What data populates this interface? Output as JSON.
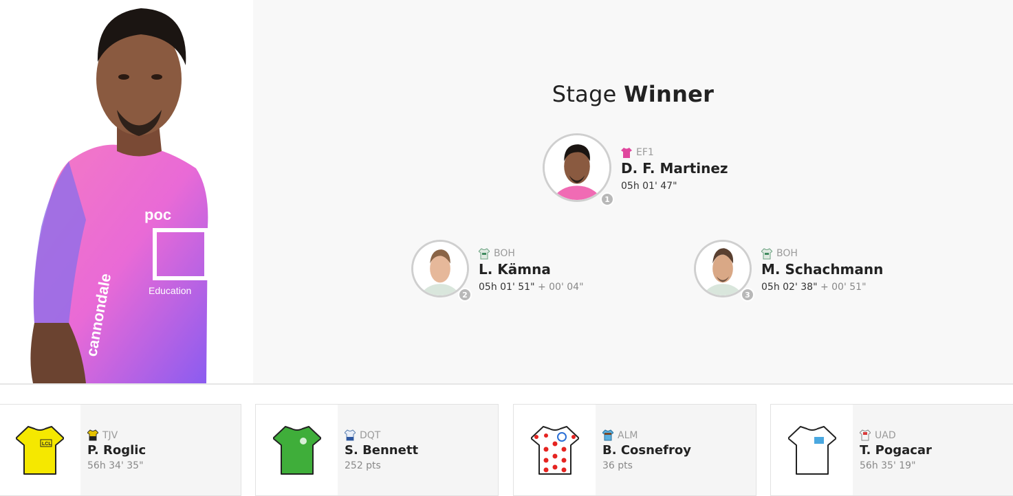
{
  "stage": {
    "title_prefix": "Stage",
    "title_bold": "Winner"
  },
  "podium": [
    {
      "rank": "1",
      "team": "EF1",
      "name": "D. F. Martinez",
      "time": "05h 01' 47\"",
      "gap": ""
    },
    {
      "rank": "2",
      "team": "BOH",
      "name": "L. Kämna",
      "time": "05h 01' 51\"",
      "gap": "+ 00' 04\""
    },
    {
      "rank": "3",
      "team": "BOH",
      "name": "M. Schachmann",
      "time": "05h 02' 38\"",
      "gap": "+ 00' 51\""
    }
  ],
  "jerseys": [
    {
      "type": "yellow",
      "team": "TJV",
      "name": "P. Roglic",
      "value": "56h 34' 35\""
    },
    {
      "type": "green",
      "team": "DQT",
      "name": "S. Bennett",
      "value": "252 pts"
    },
    {
      "type": "polka-dot",
      "team": "ALM",
      "name": "B. Cosnefroy",
      "value": "36 pts"
    },
    {
      "type": "white",
      "team": "UAD",
      "name": "T. Pogacar",
      "value": "56h 35' 19\""
    }
  ],
  "colors": {
    "panel_bg": "#f8f8f8",
    "ef_pink": "#f06bb4",
    "yellow_jersey": "#f5e800",
    "green_jersey": "#3fae3a",
    "polka_red": "#e52421"
  }
}
